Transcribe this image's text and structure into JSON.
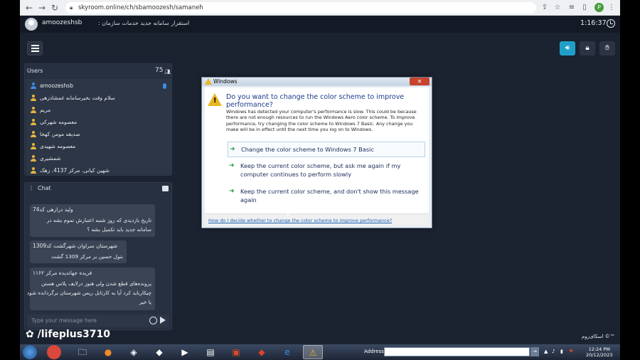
{
  "browser": {
    "url": "skyroom.online/ch/sbamoozesh/samaneh"
  },
  "app": {
    "username": "amoozeshsb",
    "room_title": "استقرار سامانه جدید خدمات سازمان :",
    "timer": "1:16:37"
  },
  "users": {
    "title": "Users",
    "count": "75",
    "list": [
      {
        "name": "amoozeshsb"
      },
      {
        "name": "سلام وقت بخیرسامانه غمشادزهی"
      },
      {
        "name": "مریم"
      },
      {
        "name": "معصومه شهرکی"
      },
      {
        "name": "صدیقه مومن کهخا"
      },
      {
        "name": "معصومه شهیدی"
      },
      {
        "name": "شمشیری"
      },
      {
        "name": "شهین کیانی. مرکز 4137. زهک"
      }
    ]
  },
  "chat": {
    "title": "Chat",
    "placeholder": "Type your message here",
    "messages": [
      {
        "sender": "ولید درازهی کد74",
        "lines": [
          "تاریخ بازدیدی که روز شنبه اعتبارش تموم بشه در",
          "سامانه جدید باید تکمیل بشه ؟"
        ]
      },
      {
        "sender": "شهرستان سراوان شهرگشت کد1309",
        "lines": [
          "بتول حسین بر مرکز 1309 گشت"
        ]
      },
      {
        "sender": "فریده جهانديده مركز ۱۱۶۲",
        "lines": [
          "پرونده‌های قطع شدن ولی هنوز درلایف پلاس هستن",
          "چیکارباید کرد آیا به کارتابل ریس شهرستان برگردانده شود",
          "یا خیر"
        ]
      }
    ]
  },
  "watermark": "/lifeplus3710",
  "brand": "اسکای‌روم ©™",
  "dialog": {
    "title": "Windows",
    "question": "Do you want to change the color scheme to improve performance?",
    "description": "Windows has detected your computer's performance is slow. This could be because there are not enough resources to run the Windows Aero color scheme. To improve performance, try changing the color scheme to Windows 7 Basic. Any change you make will be in effect until the next time you log on to Windows.",
    "options": [
      {
        "label": "Change the color scheme to Windows 7 Basic"
      },
      {
        "label": "Keep the current color scheme, but ask me again if my computer continues to perform slowly"
      },
      {
        "label": "Keep the current color scheme, and don't show this message again"
      }
    ],
    "help_link": "How do I decide whether to change the color scheme to improve performance?"
  },
  "taskbar": {
    "address_label": "Address",
    "time": "12:24 PM",
    "date": "20/12/2023"
  },
  "colors": {
    "accent": "#20a0c8",
    "panel": "#263040",
    "background": "#1c2330"
  }
}
